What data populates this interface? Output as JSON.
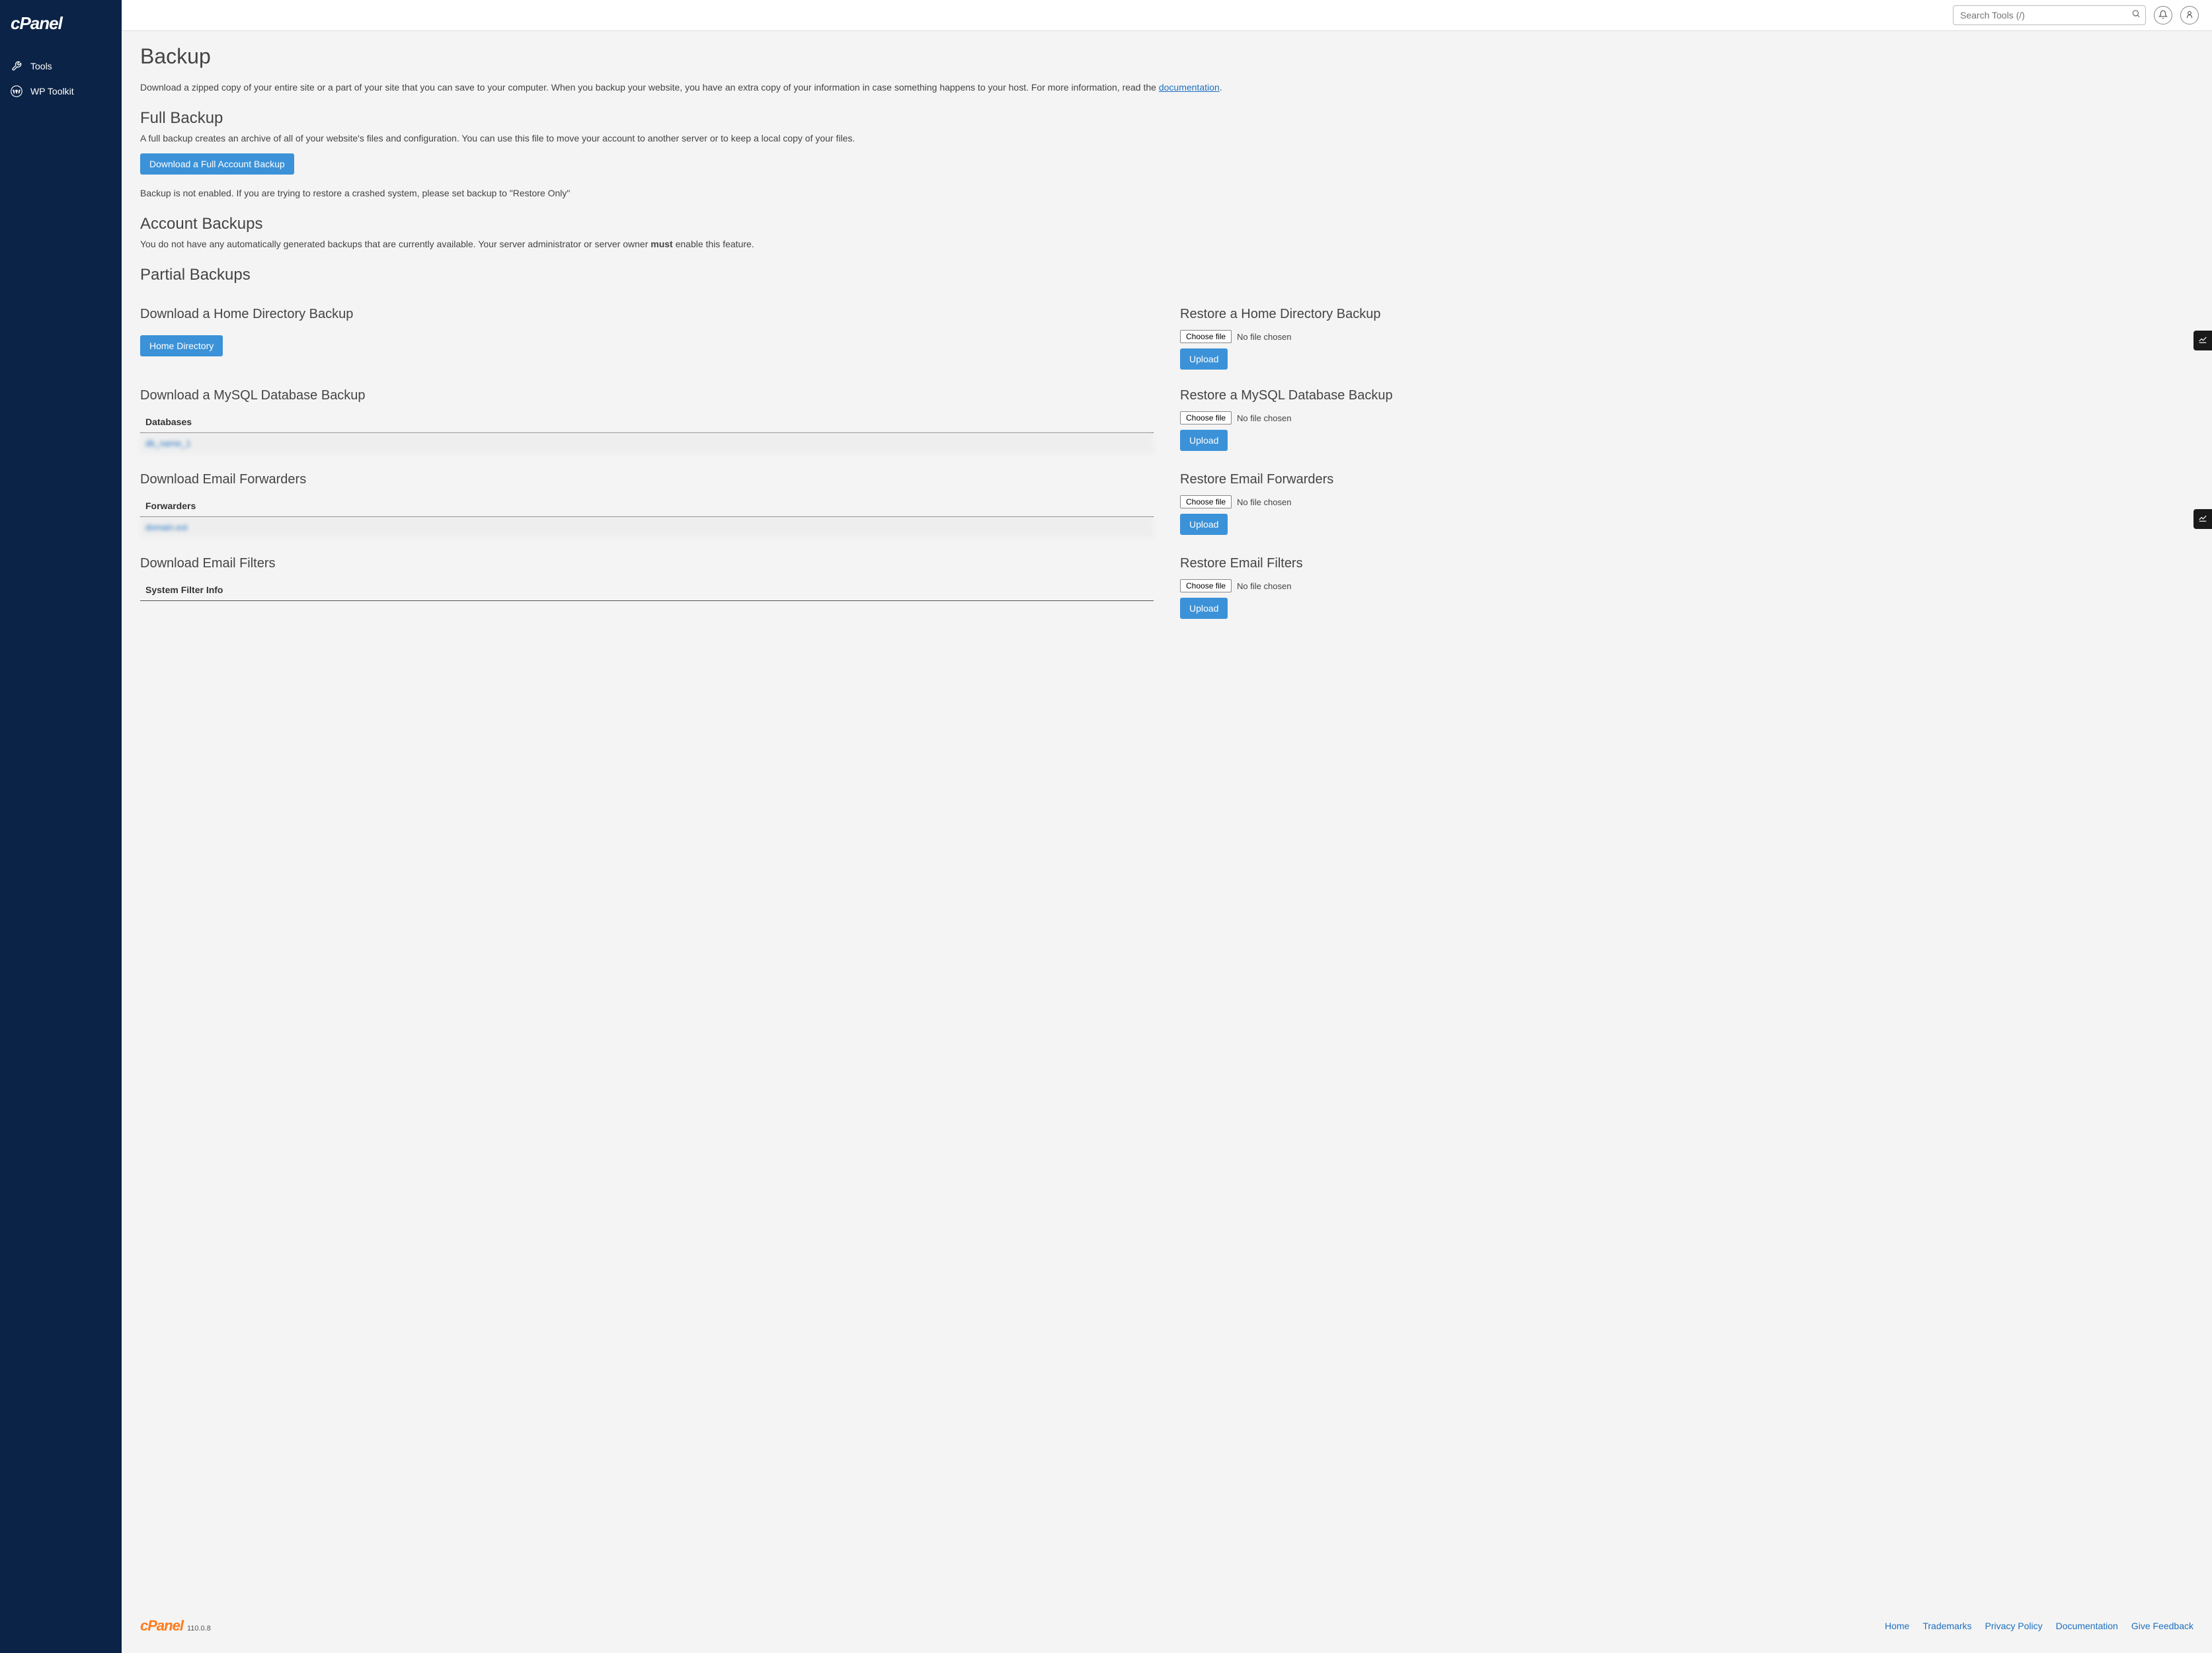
{
  "sidebar": {
    "logo": "cPanel",
    "items": [
      {
        "label": "Tools"
      },
      {
        "label": "WP Toolkit"
      }
    ]
  },
  "header": {
    "search_placeholder": "Search Tools (/)"
  },
  "page": {
    "title": "Backup",
    "intro_pre": "Download a zipped copy of your entire site or a part of your site that you can save to your computer. When you backup your website, you have an extra copy of your information in case something happens to your host. For more information, read the ",
    "intro_link": "documentation",
    "intro_post": ".",
    "full_backup": {
      "heading": "Full Backup",
      "desc": "A full backup creates an archive of all of your website's files and configuration. You can use this file to move your account to another server or to keep a local copy of your files.",
      "button": "Download a Full Account Backup",
      "note": "Backup is not enabled. If you are trying to restore a crashed system, please set backup to \"Restore Only\""
    },
    "account_backups": {
      "heading": "Account Backups",
      "desc_pre": "You do not have any automatically generated backups that are currently available. Your server administrator or server owner ",
      "desc_bold": "must",
      "desc_post": " enable this feature."
    },
    "partial": {
      "heading": "Partial Backups",
      "home_dl": {
        "heading": "Download a Home Directory Backup",
        "button": "Home Directory"
      },
      "home_restore": {
        "heading": "Restore a Home Directory Backup",
        "choose": "Choose file",
        "nofile": "No file chosen",
        "upload": "Upload"
      },
      "mysql_dl": {
        "heading": "Download a MySQL Database Backup",
        "table_header": "Databases",
        "row": "db_name_1"
      },
      "mysql_restore": {
        "heading": "Restore a MySQL Database Backup",
        "choose": "Choose file",
        "nofile": "No file chosen",
        "upload": "Upload"
      },
      "fwd_dl": {
        "heading": "Download Email Forwarders",
        "table_header": "Forwarders",
        "row": "domain.ext"
      },
      "fwd_restore": {
        "heading": "Restore Email Forwarders",
        "choose": "Choose file",
        "nofile": "No file chosen",
        "upload": "Upload"
      },
      "filter_dl": {
        "heading": "Download Email Filters",
        "table_header": "System Filter Info"
      },
      "filter_restore": {
        "heading": "Restore Email Filters",
        "choose": "Choose file",
        "nofile": "No file chosen",
        "upload": "Upload"
      }
    }
  },
  "footer": {
    "logo": "cPanel",
    "version": "110.0.8",
    "links": [
      "Home",
      "Trademarks",
      "Privacy Policy",
      "Documentation",
      "Give Feedback"
    ]
  }
}
